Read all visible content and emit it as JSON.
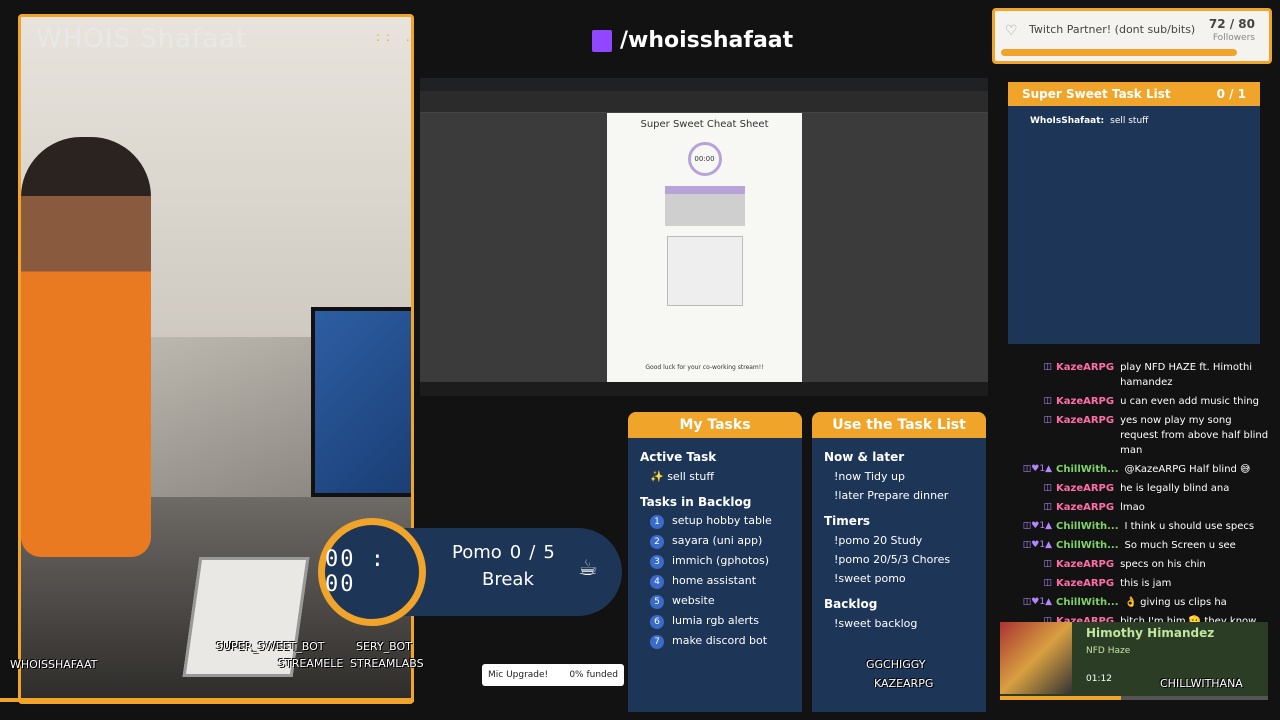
{
  "camera": {
    "title": "WHOIS Shafaat",
    "dots": ":: ."
  },
  "header": {
    "handle": "/whoisshafaat"
  },
  "cheatsheet": {
    "title": "Super Sweet Cheat Sheet",
    "timer": "00:00",
    "footer": "Good luck for your co-working stream!!"
  },
  "timer": {
    "display": "00 : 00",
    "pomo_label": "Pomo",
    "pomo_current": "0",
    "pomo_sep": "/",
    "pomo_total": "5",
    "mode": "Break",
    "cup": "☕"
  },
  "my_tasks": {
    "title": "My Tasks",
    "active_heading": "Active Task",
    "active_task": "✨ sell stuff",
    "backlog_heading": "Tasks in Backlog",
    "backlog": [
      {
        "n": "1",
        "text": "setup hobby table"
      },
      {
        "n": "2",
        "text": "sayara (uni app)"
      },
      {
        "n": "3",
        "text": "immich (gphotos)"
      },
      {
        "n": "4",
        "text": "home assistant"
      },
      {
        "n": "5",
        "text": "website"
      },
      {
        "n": "6",
        "text": "lumia rgb alerts"
      },
      {
        "n": "7",
        "text": "make discord bot"
      }
    ]
  },
  "use_tasklist": {
    "title": "Use the Task List",
    "now_heading": "Now & later",
    "now": [
      "!now Tidy up",
      "!later Prepare dinner"
    ],
    "timers_heading": "Timers",
    "timers": [
      "!pomo 20 Study",
      "!pomo 20/5/3 Chores",
      "!sweet pomo"
    ],
    "backlog_heading": "Backlog",
    "backlog": [
      "!sweet backlog"
    ]
  },
  "partner": {
    "title": "Twitch Partner! (dont sub/bits)",
    "count": "72 / 80",
    "label": "Followers",
    "progress": 0.9
  },
  "tasklist": {
    "title": "Super Sweet Task List",
    "count": "0 / 1",
    "user": "WhoIsShafaat:",
    "task": "sell stuff"
  },
  "chat": [
    {
      "user": "KazeARPG",
      "text": "play NFD HAZE ft. Himothi hamandez",
      "badges": "◫"
    },
    {
      "user": "KazeARPG",
      "text": "u can even add music thing",
      "badges": "◫"
    },
    {
      "user": "KazeARPG",
      "text": "yes now play my song request from above half blind man",
      "badges": "◫"
    },
    {
      "user": "ChillWith...",
      "text": "@KazeARPG Half blind 😅",
      "badges": "◫♥1▲"
    },
    {
      "user": "KazeARPG",
      "text": "he is legally blind ana",
      "badges": "◫"
    },
    {
      "user": "KazeARPG",
      "text": "lmao",
      "badges": "◫"
    },
    {
      "user": "ChillWith...",
      "text": "I think u should use specs",
      "badges": "◫♥1▲"
    },
    {
      "user": "ChillWith...",
      "text": "So much Screen u see",
      "badges": "◫♥1▲"
    },
    {
      "user": "KazeARPG",
      "text": "specs on his chin",
      "badges": "◫"
    },
    {
      "user": "KazeARPG",
      "text": "this is jam",
      "badges": "◫"
    },
    {
      "user": "ChillWith...",
      "text": "👌 giving us clips ha",
      "badges": "◫♥1▲"
    },
    {
      "user": "KazeARPG",
      "text": "bitch I'm him 🫡 they know that I'm him",
      "badges": "◫"
    }
  ],
  "music": {
    "song": "Himothy Himandez",
    "artist": "NFD Haze",
    "time": "01:12"
  },
  "overlay": {
    "user_left": "WHOISSHAFAAT",
    "bot1": "SUPER_SWEET_BOT",
    "bot2": "SERY_BOT",
    "bot3": "STREAMELE",
    "bot4": "STREAMLABS",
    "viewer1": "GGCHIGGY",
    "viewer2": "KAZEARPG",
    "viewer3": "CHILLWITHANA"
  },
  "mic": {
    "label": "Mic Upgrade!",
    "funded": "0% funded"
  },
  "colors": {
    "accent": "#f0a52a",
    "panel": "#1d3557",
    "twitch": "#9146ff"
  }
}
